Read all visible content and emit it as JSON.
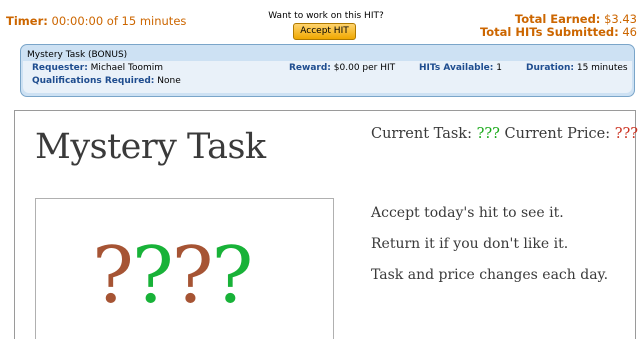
{
  "header": {
    "timer_label": "Timer:",
    "timer_value": "00:00:00 of 15 minutes",
    "work_prompt": "Want to work on this HIT?",
    "accept_button": "Accept HIT",
    "total_earned_label": "Total Earned:",
    "total_earned_value": "$3.43",
    "total_hits_label": "Total HITs Submitted:",
    "total_hits_value": "46"
  },
  "hit": {
    "title": "Mystery Task (BONUS)",
    "requester_label": "Requester:",
    "requester_value": "Michael Toomim",
    "reward_label": "Reward:",
    "reward_value": "$0.00 per HIT",
    "available_label": "HITs Available:",
    "available_value": "1",
    "duration_label": "Duration:",
    "duration_value": "15 minutes",
    "quals_label": "Qualifications Required:",
    "quals_value": "None"
  },
  "task": {
    "heading": "Mystery Task",
    "current_task_label": "Current Task:",
    "current_task_value": "???",
    "current_price_label": "Current Price:",
    "current_price_value": "???",
    "qmarks": [
      "?",
      "?",
      "?",
      "?"
    ],
    "instructions": [
      "Accept today's hit to see it.",
      "Return it if you don't like it.",
      "Task and price changes each day."
    ]
  },
  "colors": {
    "accent_orange": "#cc6600",
    "label_blue": "#1f4d8f",
    "mystery_green": "#18b238",
    "mystery_brown": "#a65434",
    "price_red": "#cc3322"
  }
}
